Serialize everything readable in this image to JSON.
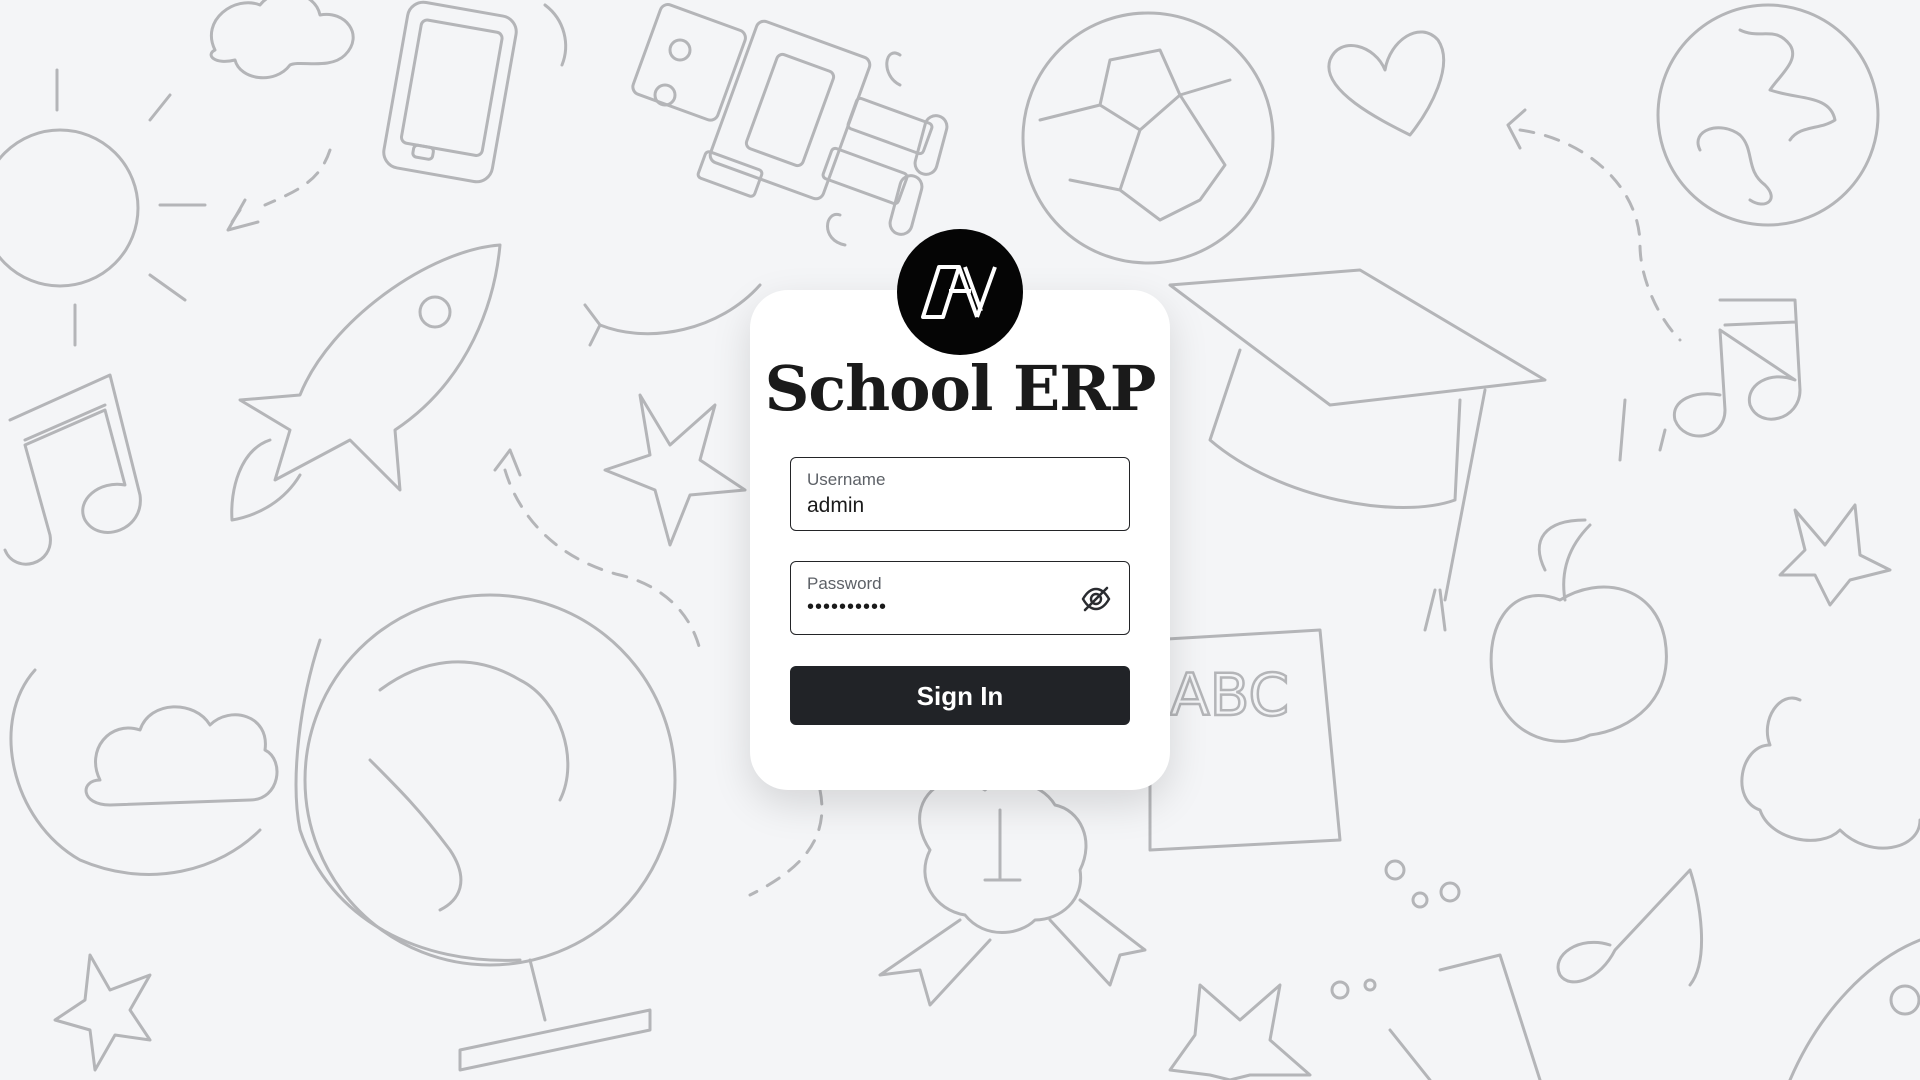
{
  "app": {
    "title": "School ERP"
  },
  "login_form": {
    "username": {
      "label": "Username",
      "value": "admin"
    },
    "password": {
      "label": "Password",
      "masked_value": "••••••••••",
      "toggle_icon": "eye-off-icon"
    },
    "submit_label": "Sign In"
  },
  "background": {
    "doodle_text": "ABC"
  },
  "colors": {
    "background": "#f4f5f7",
    "card": "#ffffff",
    "button": "#212327",
    "logo": "#050505",
    "doodle_stroke": "#b4b5b8"
  }
}
